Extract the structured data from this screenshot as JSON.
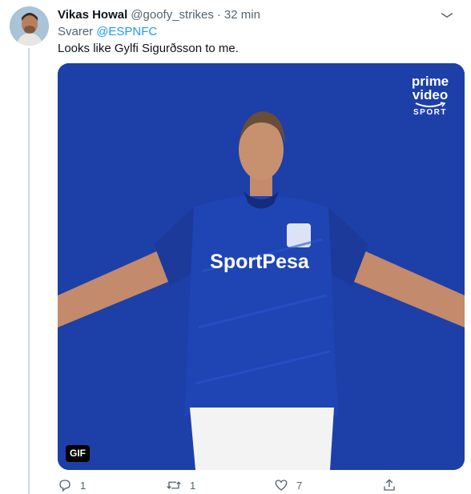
{
  "tweet": {
    "author_name": "Vikas Howal",
    "handle": "@goofy_strikes",
    "separator": "·",
    "time": "32 min",
    "reply_prefix": "Svarer",
    "reply_to": "@ESPNFC",
    "text": "Looks like Gylfi Sigurðsson to me.",
    "media": {
      "type_badge": "GIF",
      "brand": {
        "line1": "prime",
        "line2": "video",
        "line3": "SPORT"
      },
      "jersey_text": "SportPesa"
    },
    "actions": {
      "reply_count": "1",
      "retweet_count": "1",
      "like_count": "7"
    }
  },
  "colors": {
    "accent": "#1d9bf0",
    "secondary_text": "#536471",
    "media_background": "#1d3fa8",
    "thread_line": "#cfd9de"
  },
  "icons": {
    "more": "more-options-icon",
    "reply": "reply-icon",
    "retweet": "retweet-icon",
    "like": "like-icon",
    "share": "share-icon"
  }
}
